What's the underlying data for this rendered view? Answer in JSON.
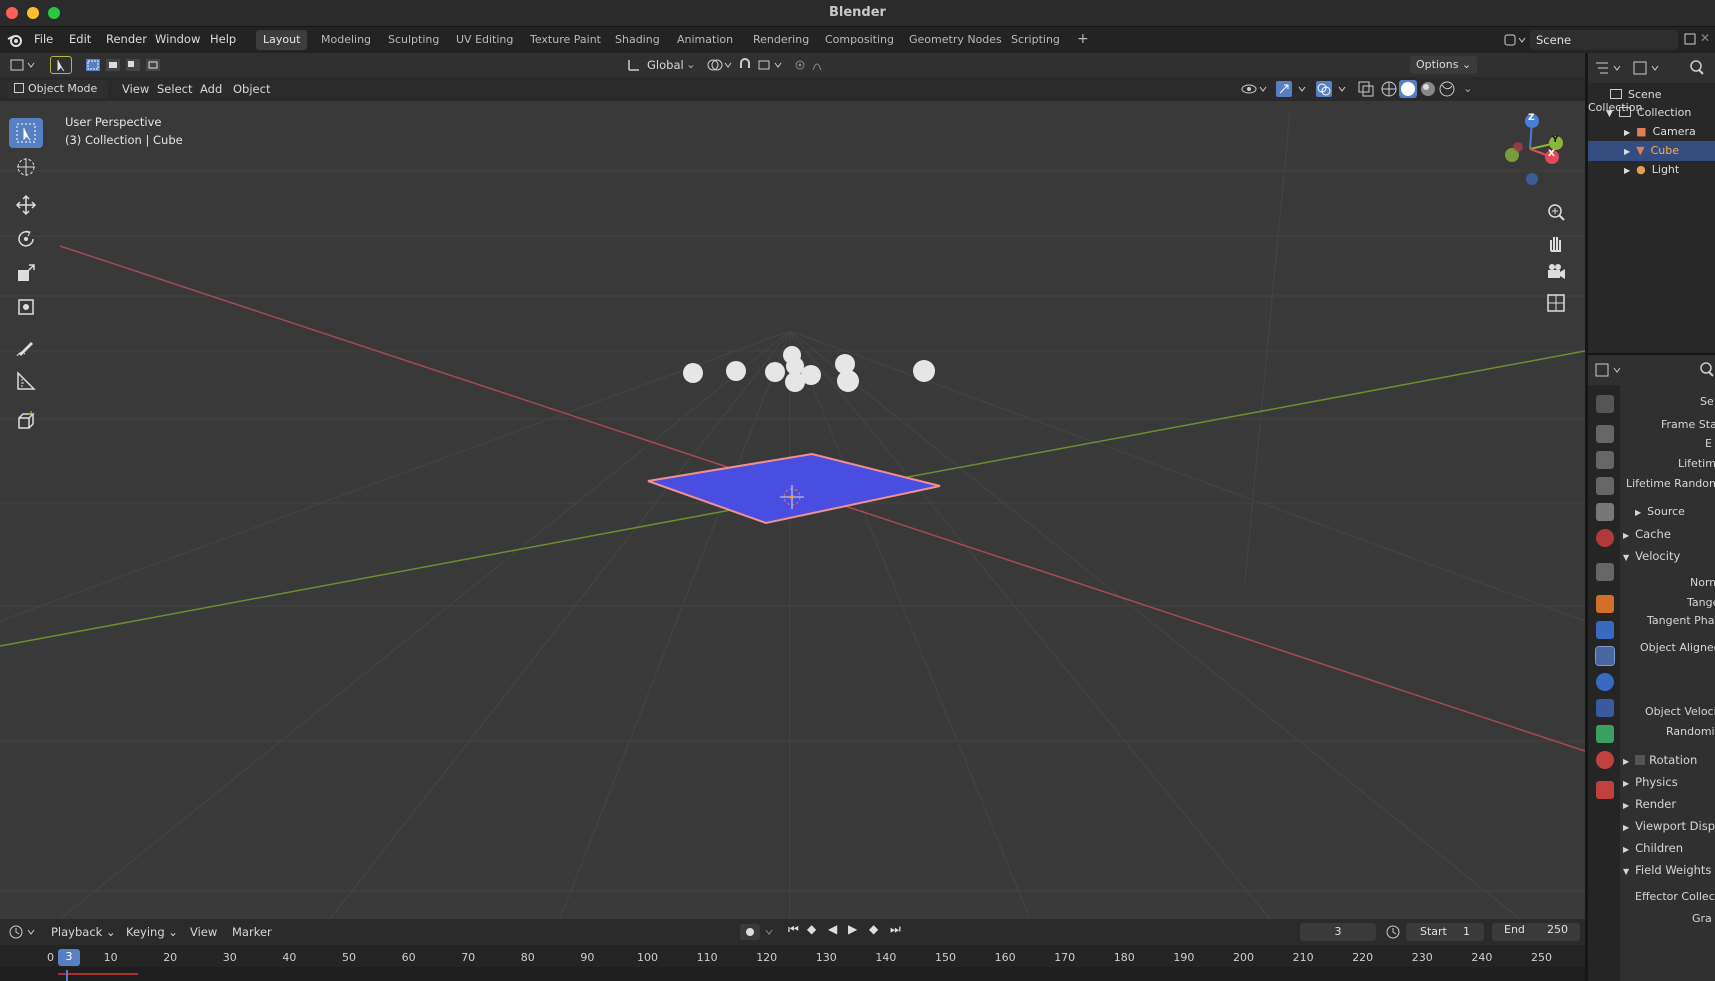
{
  "window": {
    "title": "Blender"
  },
  "menu": {
    "items": [
      "File",
      "Edit",
      "Render",
      "Window",
      "Help"
    ]
  },
  "workspaces": {
    "tabs": [
      "Layout",
      "Modeling",
      "Sculpting",
      "UV Editing",
      "Texture Paint",
      "Shading",
      "Animation",
      "Rendering",
      "Compositing",
      "Geometry Nodes",
      "Scripting"
    ],
    "active": "Layout",
    "add": "+"
  },
  "scene": {
    "name": "Scene"
  },
  "viewport_header": {
    "transform_orientation": "Global",
    "options": "Options",
    "mode": "Object Mode",
    "menus": [
      "View",
      "Select",
      "Add",
      "Object"
    ]
  },
  "viewport": {
    "perspective": "User Perspective",
    "context": "(3) Collection | Cube"
  },
  "gizmo": {
    "z": "Z",
    "y": "Y",
    "x": "X"
  },
  "outliner": {
    "root": "Scene Collection",
    "collection": "Collection",
    "items": [
      {
        "label": "Camera",
        "selected": false
      },
      {
        "label": "Cube",
        "selected": true
      },
      {
        "label": "Light",
        "selected": false
      }
    ]
  },
  "properties": {
    "rows": [
      "Se",
      "Frame Sta",
      "E",
      "Lifetim",
      "Lifetime Randomi",
      "Source",
      "Cache",
      "Velocity",
      "Norm",
      "Tange",
      "Tangent Pha",
      "Object Aligned",
      "Object Veloci",
      "Randomiz",
      "Rotation",
      "Physics",
      "Render",
      "Viewport Displ",
      "Children",
      "Field Weights",
      "Effector Collect",
      "Gra"
    ]
  },
  "timeline": {
    "menus": [
      "Playback",
      "Keying",
      "View",
      "Marker"
    ],
    "current_frame": "3",
    "start_label": "Start",
    "start_value": "1",
    "end_label": "End",
    "end_value": "250",
    "ruler_labels": [
      "0",
      "10",
      "20",
      "30",
      "40",
      "50",
      "60",
      "70",
      "80",
      "90",
      "100",
      "110",
      "120",
      "130",
      "140",
      "150",
      "160",
      "170",
      "180",
      "190",
      "200",
      "210",
      "220",
      "230",
      "240",
      "250"
    ],
    "playhead_label": "3"
  },
  "colors": {
    "accent": "#5680c2",
    "selection": "#334d80",
    "plane": "#4a4ee0",
    "plane_outline": "#f09090"
  }
}
